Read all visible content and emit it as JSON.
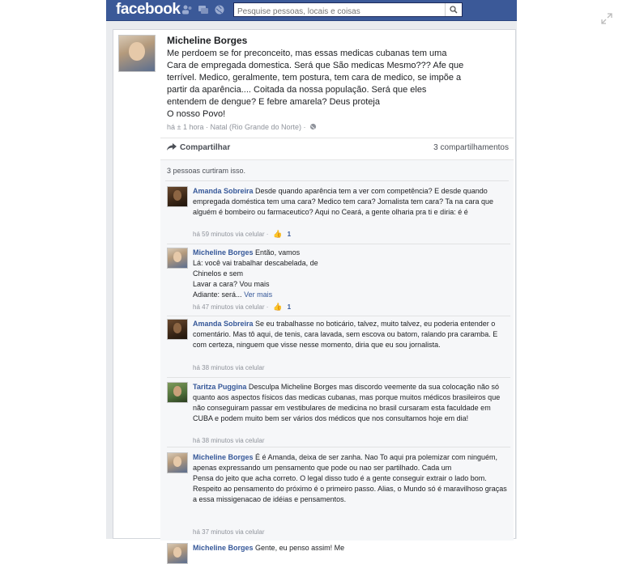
{
  "header": {
    "logo": "facebook",
    "search_placeholder": "Pesquise pessoas, locais e coisas"
  },
  "post": {
    "author": "Micheline Borges",
    "text": "Me perdoem se for preconceito, mas essas medicas cubanas tem uma\nCara de empregada domestica. Será que São medicas Mesmo??? Afe que\nterrível. Medico, geralmente, tem postura, tem cara de medico, se impõe a\npartir da aparência.... Coitada da nossa população. Será que eles\nentendem de dengue? E febre amarela? Deus proteja\nO nosso Povo!",
    "meta": "há ± 1 hora · Natal (Rio Grande do Norte) ·",
    "share_label": "Compartilhar",
    "share_count": "3 compartilhamentos",
    "likes": "3 pessoas curtiram isso."
  },
  "comments": [
    {
      "name": "Amanda Sobreira",
      "text": "Desde quando aparência tem a ver com competência? E desde quando empregada doméstica tem uma cara? Medico tem cara? Jornalista tem cara? Ta na cara que alguém é bombeiro ou farmaceutico? Aqui no Ceará, a gente olharia pra ti e diria: é é",
      "meta": "há 59 minutos via celular ·",
      "likes": "1"
    },
    {
      "name": "Micheline Borges",
      "text": "Então, vamos\nLá: você vai trabalhar descabelada, de\nChinelos e sem\nLavar a cara? Vou mais\nAdiante: será...",
      "more": "Ver mais",
      "meta": "há 47 minutos via celular ·",
      "likes": "1"
    },
    {
      "name": "Amanda Sobreira",
      "text": "Se eu trabalhasse no boticário, talvez, muito talvez, eu poderia entender o comentário. Mas tô aqui, de tenis, cara lavada, sem escova ou batom, ralando pra caramba. E com certeza, ninguem que visse nesse momento, diria que eu sou jornalista.",
      "meta": "há 38 minutos via celular"
    },
    {
      "name": "Taritza Puggina",
      "text": "Desculpa Micheline Borges mas discordo veemente da sua colocação não só quanto aos aspectos físicos das medicas cubanas, mas porque muitos médicos brasileiros que não conseguiram passar em vestibulares de medicina no brasil cursaram esta faculdade em CUBA e podem muito bem ser vários dos médicos que nos consultamos hoje em dia!",
      "meta": "há 38 minutos via celular"
    },
    {
      "name": "Micheline Borges",
      "text": "É é Amanda, deixa de ser zanha. Nao To aqui pra polemizar com ninguém, apenas expressando um pensamento que pode ou nao ser partilhado. Cada um\nPensa do jeito que acha correto. O legal disso tudo é a gente conseguir extrair o lado bom. Respeito ao pensamento do próximo é o primeiro passo. Alias, o Mundo só é maravilhoso graças a essa missigenacao de idéias e pensamentos.",
      "meta": "há 37 minutos via celular"
    },
    {
      "name": "Micheline Borges",
      "text": "Gente, eu penso assim! Me"
    }
  ]
}
